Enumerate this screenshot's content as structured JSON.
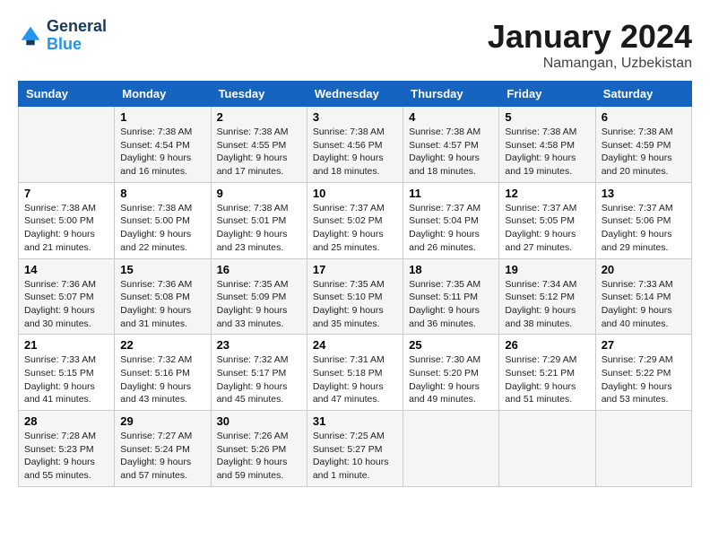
{
  "header": {
    "logo_line1": "General",
    "logo_line2": "Blue",
    "month": "January 2024",
    "location": "Namangan, Uzbekistan"
  },
  "weekdays": [
    "Sunday",
    "Monday",
    "Tuesday",
    "Wednesday",
    "Thursday",
    "Friday",
    "Saturday"
  ],
  "weeks": [
    [
      {
        "day": "",
        "info": ""
      },
      {
        "day": "1",
        "info": "Sunrise: 7:38 AM\nSunset: 4:54 PM\nDaylight: 9 hours\nand 16 minutes."
      },
      {
        "day": "2",
        "info": "Sunrise: 7:38 AM\nSunset: 4:55 PM\nDaylight: 9 hours\nand 17 minutes."
      },
      {
        "day": "3",
        "info": "Sunrise: 7:38 AM\nSunset: 4:56 PM\nDaylight: 9 hours\nand 18 minutes."
      },
      {
        "day": "4",
        "info": "Sunrise: 7:38 AM\nSunset: 4:57 PM\nDaylight: 9 hours\nand 18 minutes."
      },
      {
        "day": "5",
        "info": "Sunrise: 7:38 AM\nSunset: 4:58 PM\nDaylight: 9 hours\nand 19 minutes."
      },
      {
        "day": "6",
        "info": "Sunrise: 7:38 AM\nSunset: 4:59 PM\nDaylight: 9 hours\nand 20 minutes."
      }
    ],
    [
      {
        "day": "7",
        "info": "Sunrise: 7:38 AM\nSunset: 5:00 PM\nDaylight: 9 hours\nand 21 minutes."
      },
      {
        "day": "8",
        "info": "Sunrise: 7:38 AM\nSunset: 5:00 PM\nDaylight: 9 hours\nand 22 minutes."
      },
      {
        "day": "9",
        "info": "Sunrise: 7:38 AM\nSunset: 5:01 PM\nDaylight: 9 hours\nand 23 minutes."
      },
      {
        "day": "10",
        "info": "Sunrise: 7:37 AM\nSunset: 5:02 PM\nDaylight: 9 hours\nand 25 minutes."
      },
      {
        "day": "11",
        "info": "Sunrise: 7:37 AM\nSunset: 5:04 PM\nDaylight: 9 hours\nand 26 minutes."
      },
      {
        "day": "12",
        "info": "Sunrise: 7:37 AM\nSunset: 5:05 PM\nDaylight: 9 hours\nand 27 minutes."
      },
      {
        "day": "13",
        "info": "Sunrise: 7:37 AM\nSunset: 5:06 PM\nDaylight: 9 hours\nand 29 minutes."
      }
    ],
    [
      {
        "day": "14",
        "info": "Sunrise: 7:36 AM\nSunset: 5:07 PM\nDaylight: 9 hours\nand 30 minutes."
      },
      {
        "day": "15",
        "info": "Sunrise: 7:36 AM\nSunset: 5:08 PM\nDaylight: 9 hours\nand 31 minutes."
      },
      {
        "day": "16",
        "info": "Sunrise: 7:35 AM\nSunset: 5:09 PM\nDaylight: 9 hours\nand 33 minutes."
      },
      {
        "day": "17",
        "info": "Sunrise: 7:35 AM\nSunset: 5:10 PM\nDaylight: 9 hours\nand 35 minutes."
      },
      {
        "day": "18",
        "info": "Sunrise: 7:35 AM\nSunset: 5:11 PM\nDaylight: 9 hours\nand 36 minutes."
      },
      {
        "day": "19",
        "info": "Sunrise: 7:34 AM\nSunset: 5:12 PM\nDaylight: 9 hours\nand 38 minutes."
      },
      {
        "day": "20",
        "info": "Sunrise: 7:33 AM\nSunset: 5:14 PM\nDaylight: 9 hours\nand 40 minutes."
      }
    ],
    [
      {
        "day": "21",
        "info": "Sunrise: 7:33 AM\nSunset: 5:15 PM\nDaylight: 9 hours\nand 41 minutes."
      },
      {
        "day": "22",
        "info": "Sunrise: 7:32 AM\nSunset: 5:16 PM\nDaylight: 9 hours\nand 43 minutes."
      },
      {
        "day": "23",
        "info": "Sunrise: 7:32 AM\nSunset: 5:17 PM\nDaylight: 9 hours\nand 45 minutes."
      },
      {
        "day": "24",
        "info": "Sunrise: 7:31 AM\nSunset: 5:18 PM\nDaylight: 9 hours\nand 47 minutes."
      },
      {
        "day": "25",
        "info": "Sunrise: 7:30 AM\nSunset: 5:20 PM\nDaylight: 9 hours\nand 49 minutes."
      },
      {
        "day": "26",
        "info": "Sunrise: 7:29 AM\nSunset: 5:21 PM\nDaylight: 9 hours\nand 51 minutes."
      },
      {
        "day": "27",
        "info": "Sunrise: 7:29 AM\nSunset: 5:22 PM\nDaylight: 9 hours\nand 53 minutes."
      }
    ],
    [
      {
        "day": "28",
        "info": "Sunrise: 7:28 AM\nSunset: 5:23 PM\nDaylight: 9 hours\nand 55 minutes."
      },
      {
        "day": "29",
        "info": "Sunrise: 7:27 AM\nSunset: 5:24 PM\nDaylight: 9 hours\nand 57 minutes."
      },
      {
        "day": "30",
        "info": "Sunrise: 7:26 AM\nSunset: 5:26 PM\nDaylight: 9 hours\nand 59 minutes."
      },
      {
        "day": "31",
        "info": "Sunrise: 7:25 AM\nSunset: 5:27 PM\nDaylight: 10 hours\nand 1 minute."
      },
      {
        "day": "",
        "info": ""
      },
      {
        "day": "",
        "info": ""
      },
      {
        "day": "",
        "info": ""
      }
    ]
  ]
}
